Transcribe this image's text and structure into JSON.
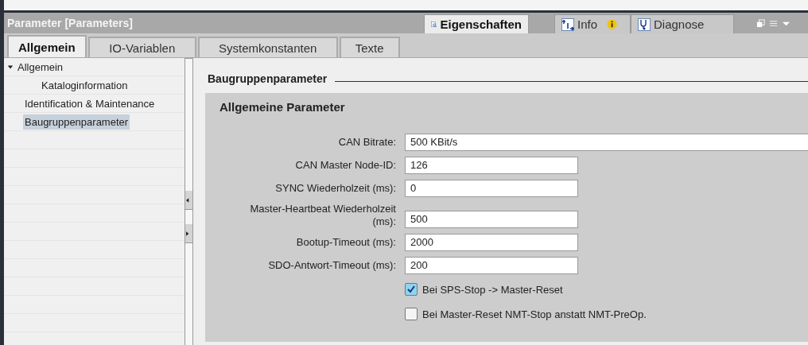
{
  "title_bar": {
    "title": "Parameter [Parameters]",
    "tabs": [
      {
        "label": "Eigenschaften",
        "selected": true,
        "kind": "properties"
      },
      {
        "label": "Info",
        "selected": false,
        "kind": "info",
        "badge": true
      },
      {
        "label": "Diagnose",
        "selected": false,
        "kind": "diagnose"
      }
    ]
  },
  "subtabs": [
    {
      "label": "Allgemein",
      "selected": true
    },
    {
      "label": "IO-Variablen",
      "selected": false
    },
    {
      "label": "Systemkonstanten",
      "selected": false
    },
    {
      "label": "Texte",
      "selected": false
    }
  ],
  "tree": [
    {
      "label": "Allgemein",
      "selected": false,
      "expanded": true,
      "children": [
        {
          "label": "Kataloginformation",
          "selected": false
        }
      ]
    },
    {
      "label": "Identification & Maintenance",
      "selected": false
    },
    {
      "label": "Baugruppenparameter",
      "selected": true
    }
  ],
  "section_title": "Baugruppenparameter",
  "group": {
    "title": "Allgemeine Parameter",
    "params": [
      {
        "label": "CAN Bitrate:",
        "value": "500 KBit/s",
        "kind": "select"
      },
      {
        "label": "CAN Master Node-ID:",
        "value": "126",
        "kind": "input"
      },
      {
        "label": "SYNC Wiederholzeit (ms):",
        "value": "0",
        "kind": "input"
      },
      {
        "label": "Master-Heartbeat Wiederholzeit (ms):",
        "value": "500",
        "kind": "input"
      },
      {
        "label": "Bootup-Timeout (ms):",
        "value": "2000",
        "kind": "input"
      },
      {
        "label": "SDO-Antwort-Timeout (ms):",
        "value": "200",
        "kind": "input"
      }
    ],
    "checkboxes": [
      {
        "label": "Bei SPS-Stop -> Master-Reset",
        "checked": true
      },
      {
        "label": "Bei Master-Reset NMT-Stop anstatt NMT-PreOp.",
        "checked": false
      }
    ]
  }
}
